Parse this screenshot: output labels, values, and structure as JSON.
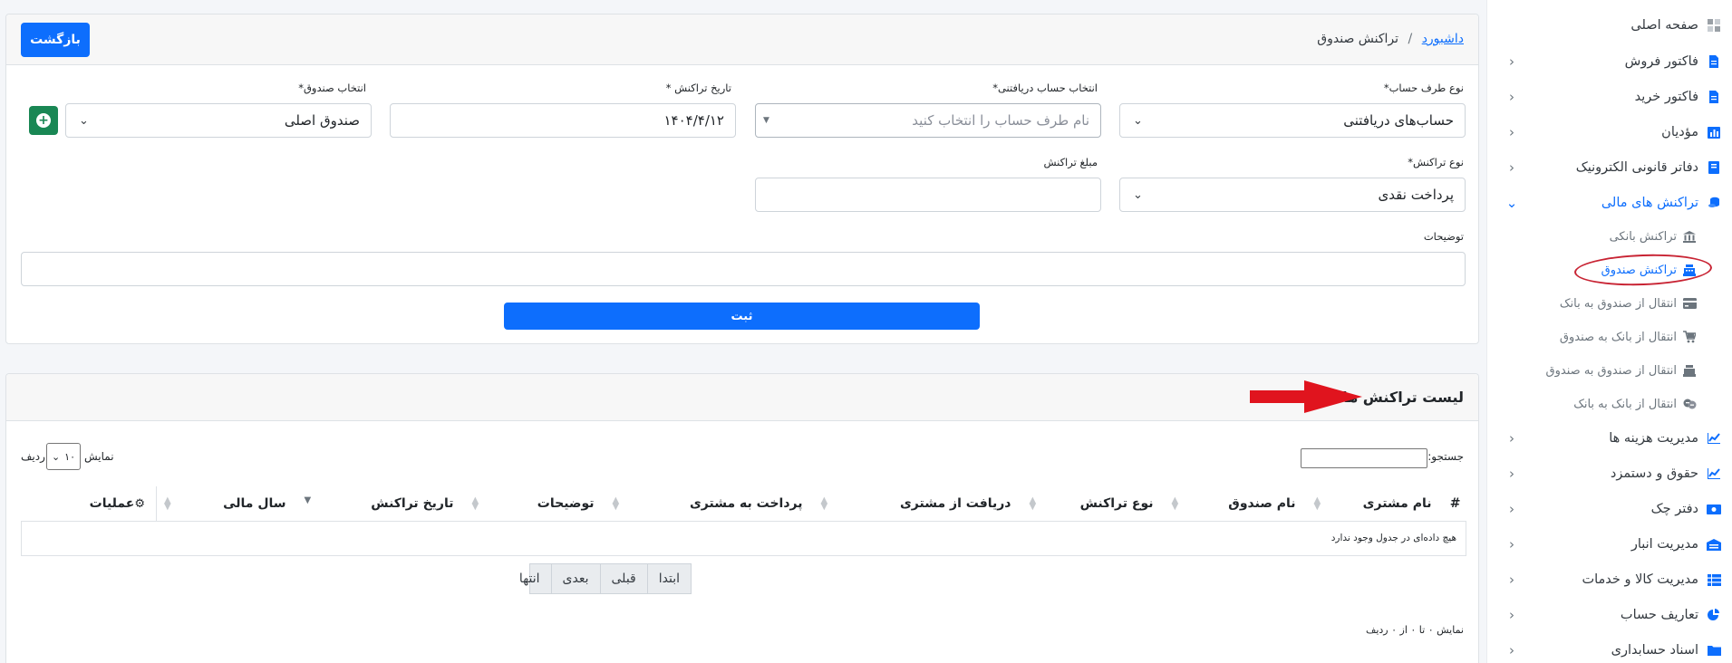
{
  "sidebar": {
    "items": [
      {
        "label": "صفحه اصلی",
        "icon": "dashboard-icon"
      },
      {
        "label": "فاکتور فروش",
        "icon": "invoice-icon"
      },
      {
        "label": "فاکتور خرید",
        "icon": "invoice-icon"
      },
      {
        "label": "مؤدیان",
        "icon": "chart-icon"
      },
      {
        "label": "دفاتر قانونی الکترونیک",
        "icon": "book-icon"
      },
      {
        "label": "تراکنش های مالی",
        "icon": "coins-icon"
      },
      {
        "label": "مدیریت هزینه ها",
        "icon": "line-chart-icon"
      },
      {
        "label": "حقوق و دستمزد",
        "icon": "line-chart-icon"
      },
      {
        "label": "دفتر چک",
        "icon": "money-bill-icon"
      },
      {
        "label": "مدیریت انبار",
        "icon": "warehouse-icon"
      },
      {
        "label": "مدیریت کالا و خدمات",
        "icon": "list-icon"
      },
      {
        "label": "تعاریف حساب",
        "icon": "pie-chart-icon"
      },
      {
        "label": "اسناد حسابداری",
        "icon": "folder-icon"
      }
    ],
    "sub_items": [
      {
        "label": "تراکنش بانکی",
        "icon": "bank-icon"
      },
      {
        "label": "تراکنش صندوق",
        "icon": "cash-register-icon"
      },
      {
        "label": "انتقال از صندوق به بانک",
        "icon": "credit-card-icon"
      },
      {
        "label": "انتقال از بانک به صندوق",
        "icon": "cart-icon"
      },
      {
        "label": "انتقال از صندوق به صندوق",
        "icon": "cash-register-icon"
      },
      {
        "label": "انتقال از بانک به بانک",
        "icon": "handshake-icon"
      }
    ]
  },
  "header": {
    "breadcrumb_link": "داشبورد",
    "breadcrumb_sep": "/",
    "breadcrumb_current": "تراکنش صندوق",
    "back_label": "بازگشت"
  },
  "form": {
    "party_type_label": "نوع طرف حساب*",
    "party_type_value": "حساب‌های دریافتنی",
    "receivable_account_label": "انتخاب حساب دریافتنی*",
    "receivable_account_placeholder": "نام طرف حساب را انتخاب کنید",
    "date_label": "تاریخ تراکنش *",
    "date_value": "۱۴۰۴/۴/۱۲",
    "fund_label": "انتخاب صندوق*",
    "fund_value": "صندوق اصلی",
    "transaction_type_label": "نوع تراکنش*",
    "transaction_type_value": "پرداخت نقدی",
    "amount_label": "مبلغ تراکنش",
    "amount_value": "",
    "description_label": "توضیحات",
    "description_value": "",
    "submit_label": "ثبت"
  },
  "list": {
    "title": "لیست تراکنش ها",
    "search_label": "جستجو:",
    "search_value": "",
    "length_show": "نمایش",
    "length_value": "۱۰",
    "length_rows": "ردیف",
    "columns": [
      "#",
      "نام مشتری",
      "نام صندوق",
      "نوع تراکنش",
      "دریافت از مشتری",
      "پرداخت به مشتری",
      "توضیحات",
      "تاریخ تراکنش",
      "سال مالی",
      "عملیات"
    ],
    "empty_message": "هیچ داده‌ای در جدول وجود ندارد",
    "pagination": [
      "ابتدا",
      "قبلی",
      "بعدی",
      "انتها"
    ],
    "info": "نمایش ۰ تا ۰ از ۰ ردیف"
  },
  "colors": {
    "primary": "#0d6efd",
    "success": "#198754",
    "annotation_red": "#e0141e"
  }
}
